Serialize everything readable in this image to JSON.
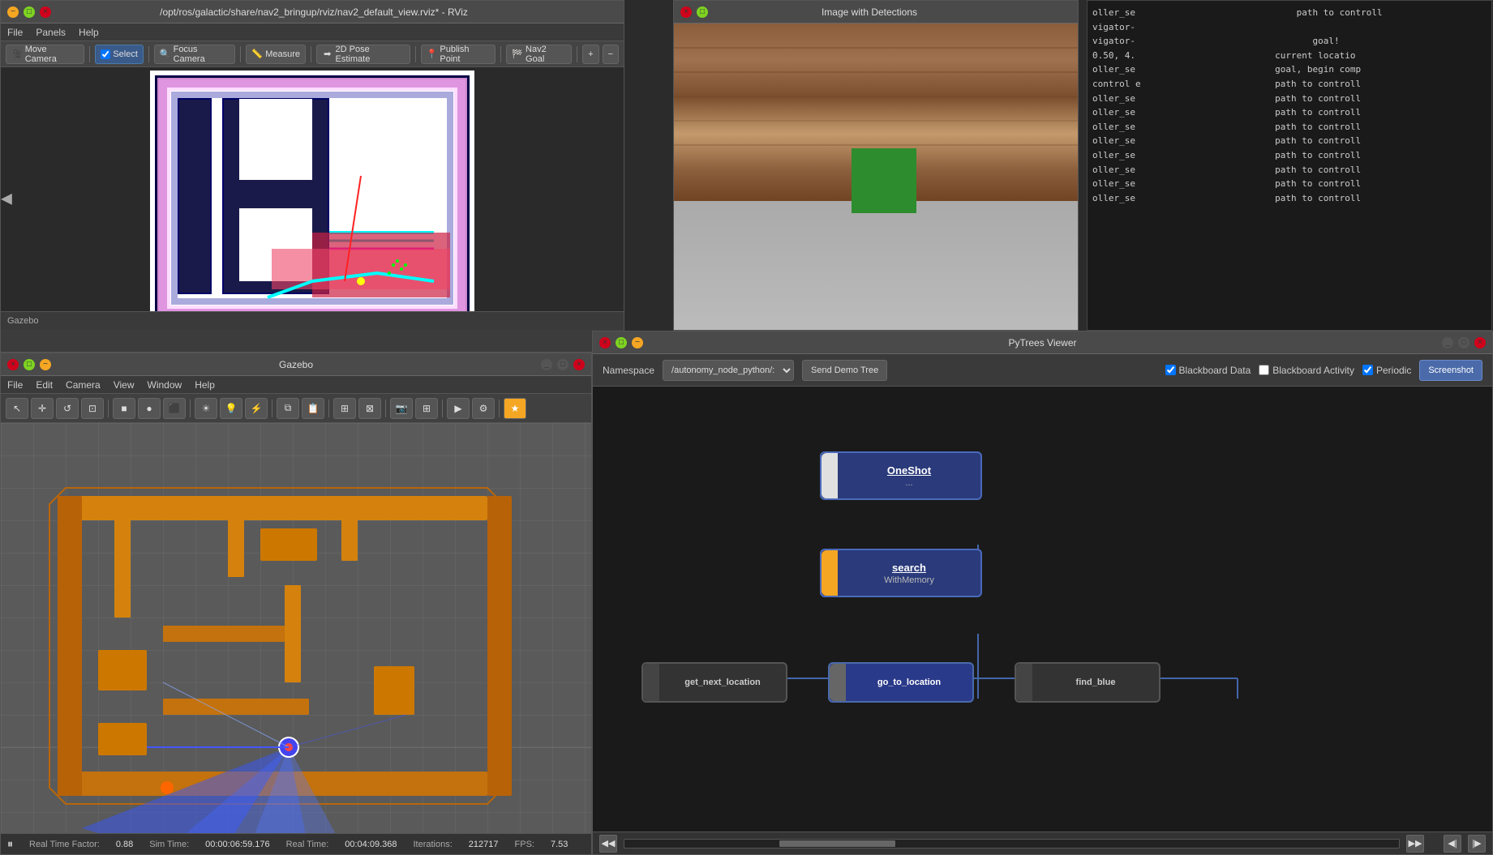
{
  "rviz": {
    "title": "/opt/ros/galactic/share/nav2_bringup/rviz/nav2_default_view.rviz* - RViz",
    "menu": {
      "file": "File",
      "panels": "Panels",
      "help": "Help"
    },
    "toolbar": {
      "move_camera": "Move Camera",
      "select": "Select",
      "focus_camera": "Focus Camera",
      "measure": "Measure",
      "pose_estimate": "2D Pose Estimate",
      "publish_point": "Publish Point",
      "nav2_goal": "Nav2 Goal"
    }
  },
  "detection": {
    "title": "Image with Detections"
  },
  "console": {
    "lines": [
      "oller_se",
      "vigator-",
      "vigator-",
      "0.50, 4.",
      "oller_se",
      "control e",
      "oller_se",
      "oller_se",
      "oller_se",
      "oller_se",
      "oller_se",
      "oller_se",
      "oller_se",
      "oller_se"
    ],
    "right_texts": [
      "path to controll",
      "vigator-",
      "goal!",
      "current locatio",
      "goal, begin comp",
      "path to controll",
      "path to controll",
      "path to controll",
      "path to controll",
      "path to controll",
      "path to controll",
      "path to controll",
      "path to controll"
    ]
  },
  "gazebo": {
    "title": "Gazebo",
    "menu": {
      "file": "File",
      "edit": "Edit",
      "camera": "Camera",
      "view": "View",
      "window": "Window",
      "help": "Help"
    },
    "status": {
      "real_time_label": "Real Time Factor:",
      "real_time_value": "0.88",
      "sim_time_label": "Sim Time:",
      "sim_time_value": "00:00:06:59.176",
      "real_time2_label": "Real Time:",
      "real_time2_value": "00:04:09.368",
      "iterations_label": "Iterations:",
      "iterations_value": "212717",
      "fps_label": "FPS:",
      "fps_value": "7.53"
    }
  },
  "pytrees": {
    "title": "PyTrees Viewer",
    "namespace_label": "Namespace",
    "namespace_value": "/autonomy_node_python/:",
    "send_demo_tree": "Send Demo Tree",
    "blackboard_data_label": "Blackboard Data",
    "blackboard_activity_label": "Blackboard Activity",
    "periodic_label": "Periodic",
    "screenshot_label": "Screenshot",
    "nodes": {
      "oneshot": {
        "title": "OneShot",
        "subtitle": "..."
      },
      "search": {
        "title": "search",
        "subtitle": "WithMemory"
      },
      "get_next_location": {
        "title": "get_next_location"
      },
      "go_to_location": {
        "title": "go_to_location"
      },
      "find_blue": {
        "title": "find_blue"
      }
    }
  }
}
